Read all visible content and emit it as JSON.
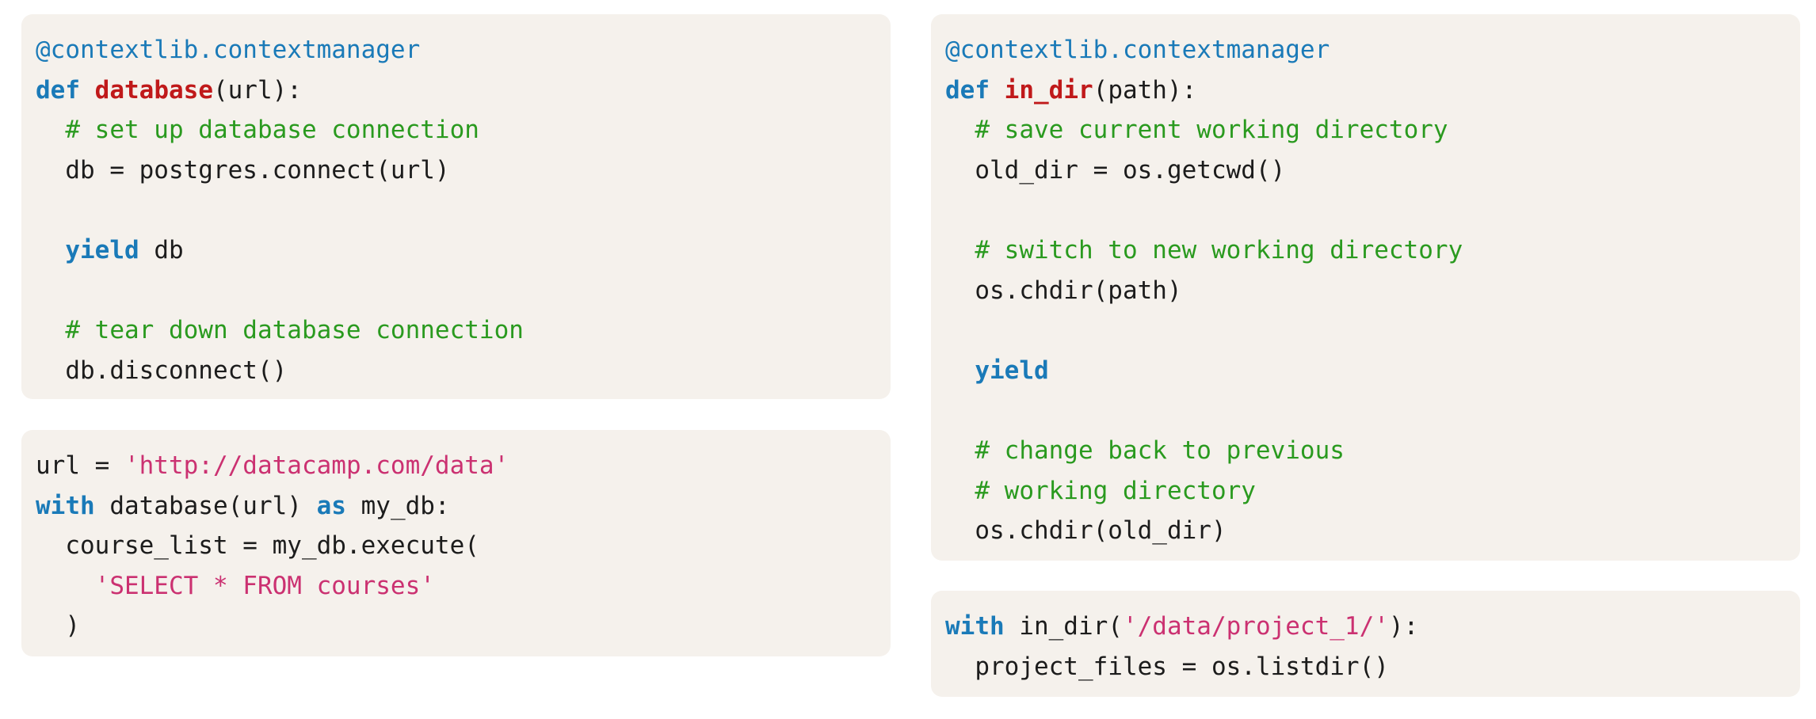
{
  "blocks": [
    {
      "id": "block-tl",
      "name": "code-block-database-contextmanager",
      "lines": [
        [
          {
            "t": "@contextlib.contextmanager",
            "k": "decorator"
          }
        ],
        [
          {
            "t": "def",
            "k": "keyword"
          },
          {
            "t": " ",
            "k": "plain"
          },
          {
            "t": "database",
            "k": "funcname"
          },
          {
            "t": "(url):",
            "k": "plain"
          }
        ],
        [
          {
            "t": "  ",
            "k": "plain"
          },
          {
            "t": "# set up database connection",
            "k": "comment"
          }
        ],
        [
          {
            "t": "  db = postgres.connect(url)",
            "k": "plain"
          }
        ],
        [],
        [
          {
            "t": "  ",
            "k": "plain"
          },
          {
            "t": "yield",
            "k": "keyword"
          },
          {
            "t": " db",
            "k": "plain"
          }
        ],
        [],
        [
          {
            "t": "  ",
            "k": "plain"
          },
          {
            "t": "# tear down database connection",
            "k": "comment"
          }
        ],
        [
          {
            "t": "  db.disconnect()",
            "k": "plain"
          }
        ]
      ]
    },
    {
      "id": "block-bl",
      "name": "code-block-database-usage",
      "lines": [
        [
          {
            "t": "url = ",
            "k": "plain"
          },
          {
            "t": "'http://datacamp.com/data'",
            "k": "string"
          }
        ],
        [
          {
            "t": "with",
            "k": "keyword"
          },
          {
            "t": " database(url) ",
            "k": "plain"
          },
          {
            "t": "as",
            "k": "keyword"
          },
          {
            "t": " my_db:",
            "k": "plain"
          }
        ],
        [
          {
            "t": "  course_list = my_db.execute(",
            "k": "plain"
          }
        ],
        [
          {
            "t": "    ",
            "k": "plain"
          },
          {
            "t": "'SELECT * FROM courses'",
            "k": "string"
          }
        ],
        [
          {
            "t": "  )",
            "k": "plain"
          }
        ]
      ]
    },
    {
      "id": "block-tr",
      "name": "code-block-in-dir-contextmanager",
      "lines": [
        [
          {
            "t": "@contextlib.contextmanager",
            "k": "decorator"
          }
        ],
        [
          {
            "t": "def",
            "k": "keyword"
          },
          {
            "t": " ",
            "k": "plain"
          },
          {
            "t": "in_dir",
            "k": "funcname"
          },
          {
            "t": "(path):",
            "k": "plain"
          }
        ],
        [
          {
            "t": "  ",
            "k": "plain"
          },
          {
            "t": "# save current working directory",
            "k": "comment"
          }
        ],
        [
          {
            "t": "  old_dir = os.getcwd()",
            "k": "plain"
          }
        ],
        [],
        [
          {
            "t": "  ",
            "k": "plain"
          },
          {
            "t": "# switch to new working directory",
            "k": "comment"
          }
        ],
        [
          {
            "t": "  os.chdir(path)",
            "k": "plain"
          }
        ],
        [],
        [
          {
            "t": "  ",
            "k": "plain"
          },
          {
            "t": "yield",
            "k": "keyword"
          }
        ],
        [],
        [
          {
            "t": "  ",
            "k": "plain"
          },
          {
            "t": "# change back to previous",
            "k": "comment"
          }
        ],
        [
          {
            "t": "  ",
            "k": "plain"
          },
          {
            "t": "# working directory",
            "k": "comment"
          }
        ],
        [
          {
            "t": "  os.chdir(old_dir)",
            "k": "plain"
          }
        ]
      ]
    },
    {
      "id": "block-br",
      "name": "code-block-in-dir-usage",
      "lines": [
        [
          {
            "t": "with",
            "k": "keyword"
          },
          {
            "t": " in_dir(",
            "k": "plain"
          },
          {
            "t": "'/data/project_1/'",
            "k": "string"
          },
          {
            "t": "):",
            "k": "plain"
          }
        ],
        [
          {
            "t": "  project_files = os.listdir()",
            "k": "plain"
          }
        ]
      ]
    }
  ]
}
